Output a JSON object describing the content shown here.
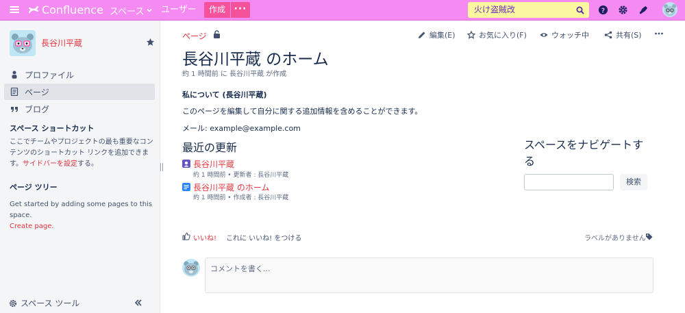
{
  "header": {
    "app_name": "Confluence",
    "spaces_label": "スペース",
    "people_label": "ユーザー",
    "create_label": "作成",
    "more_label": "···",
    "search_value": "火け盗賊改",
    "bar_color": "#f58af3",
    "create_color": "#f4529a",
    "search_bg": "#fbf6a0",
    "icons": [
      "menu-icon",
      "confluence-logo-icon",
      "chevron-down-icon",
      "search-icon",
      "help-icon",
      "settings-icon",
      "notifications-icon",
      "user-avatar"
    ]
  },
  "sidebar": {
    "space_name": "長谷川平蔵",
    "items": [
      {
        "label": "プロファイル",
        "icon": "person-icon"
      },
      {
        "label": "ページ",
        "icon": "page-icon"
      },
      {
        "label": "ブログ",
        "icon": "quote-icon"
      }
    ],
    "shortcuts_heading": "スペース ショートカット",
    "shortcuts_text_before": "ここでチームやプロジェクトの最も重要なコンテンツのショートカット リンクを追加できます。",
    "shortcuts_link": "サイドバーを設定",
    "shortcuts_text_after": "する。",
    "tree_heading": "ページ ツリー",
    "tree_text": "Get started by adding some pages to this space.",
    "tree_link": "Create page.",
    "tools_label": "スペース ツール"
  },
  "main": {
    "breadcrumb": "ページ",
    "actions": {
      "edit": "編集(E)",
      "favorite": "お気に入り(F)",
      "watch": "ウォッチ中",
      "share": "共有(S)"
    },
    "title": "長谷川平蔵 のホーム",
    "byline": "約 1 時間前 に 長谷川平蔵 が作成",
    "about_heading": "私について (長谷川平蔵)",
    "about_text": "このページを編集して自分に関する追加情報を含めることができます。",
    "email_line": "メール: example@example.com",
    "recent_heading": "最近の更新",
    "recent": [
      {
        "title": "長谷川平蔵",
        "meta": "約 1 時間前 • 更新者 : 長谷川平蔵",
        "icon": "profile-icon"
      },
      {
        "title": "長谷川平蔵 のホーム",
        "meta": "約 1 時間前 • 作成者 : 長谷川平蔵",
        "icon": "page-icon"
      }
    ],
    "navigate_heading": "スペースをナビゲートする",
    "navigate_search_value": "",
    "navigate_search_button": "検索",
    "like_label": "いいね!",
    "like_prompt": "これに いいね! をつける",
    "no_labels": "ラベルがありません",
    "comment_placeholder": "コメントを書く...",
    "link_color": "#e0343e"
  }
}
